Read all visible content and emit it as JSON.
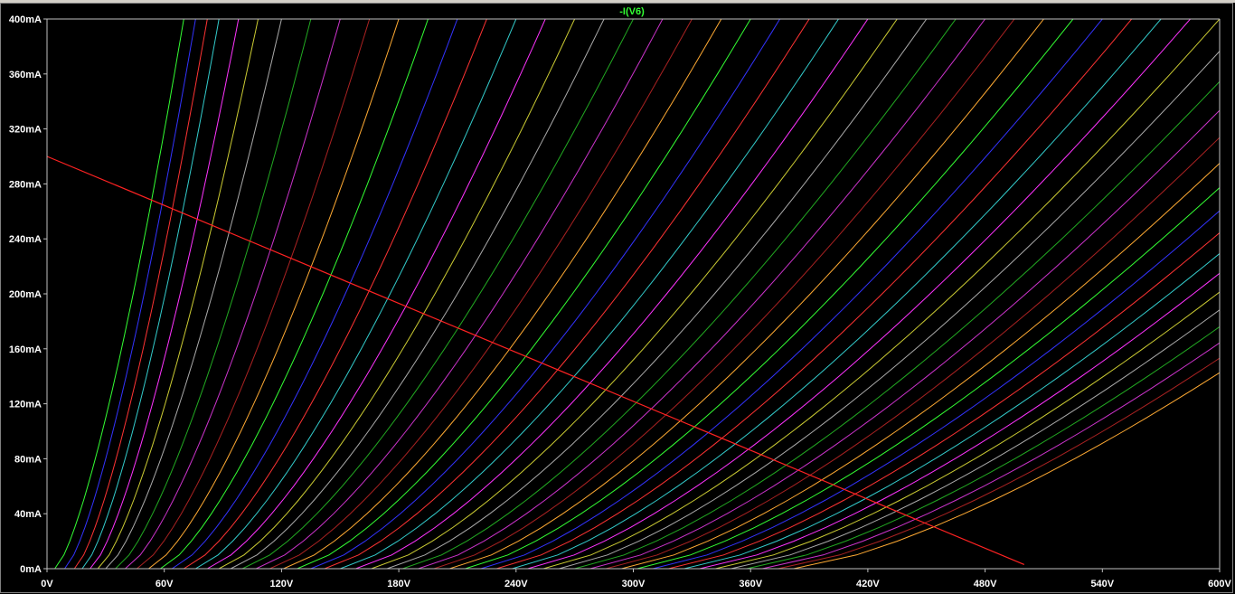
{
  "chart_data": {
    "type": "line",
    "title": "-I(V6)",
    "title_color": "#33ff33",
    "background": "#000000",
    "axis_color": "#c0c0c0",
    "xlabel": "",
    "ylabel": "",
    "xlim": [
      0,
      600
    ],
    "ylim": [
      0,
      400
    ],
    "x_ticks": [
      "0V",
      "60V",
      "120V",
      "180V",
      "240V",
      "300V",
      "360V",
      "420V",
      "480V",
      "540V",
      "600V"
    ],
    "y_ticks": [
      "0mA",
      "40mA",
      "80mA",
      "120mA",
      "160mA",
      "200mA",
      "240mA",
      "280mA",
      "320mA",
      "360mA",
      "400mA"
    ],
    "grid": false,
    "curve_family": {
      "description_units": "plate voltage (V) vs plate current (mA)",
      "colors": [
        "#33ff33",
        "#3333ff",
        "#ff3333",
        "#33cccc",
        "#ff33ff",
        "#cccc33",
        "#aaaaaa",
        "#22aa22",
        "#cc33cc",
        "#aa2222",
        "#ffaa33"
      ],
      "knee_points_v_at_0mA": [
        4,
        9,
        14,
        18,
        22,
        26,
        30,
        35,
        40,
        46,
        52,
        58,
        64,
        70,
        76,
        82,
        88,
        94,
        100,
        107,
        114,
        121,
        128,
        135,
        142,
        150,
        158,
        166,
        174,
        182,
        190,
        198,
        206,
        214,
        222,
        230,
        238,
        246,
        254,
        262,
        270,
        278,
        286,
        294,
        302,
        310,
        318,
        326,
        334,
        342,
        350,
        358,
        366,
        374,
        382,
        390
      ],
      "v_at_400mA": [
        70,
        76,
        82,
        88,
        98,
        108,
        120,
        135,
        150,
        165,
        180,
        195,
        210,
        225,
        240,
        255,
        270,
        285,
        300,
        315,
        330,
        345,
        360,
        375,
        390,
        405,
        420,
        435,
        450,
        465,
        480,
        495,
        510,
        525,
        540,
        555,
        570,
        585,
        600
      ]
    },
    "load_line": {
      "color": "#ff2222",
      "points": [
        [
          0,
          300
        ],
        [
          500,
          3
        ]
      ]
    }
  }
}
